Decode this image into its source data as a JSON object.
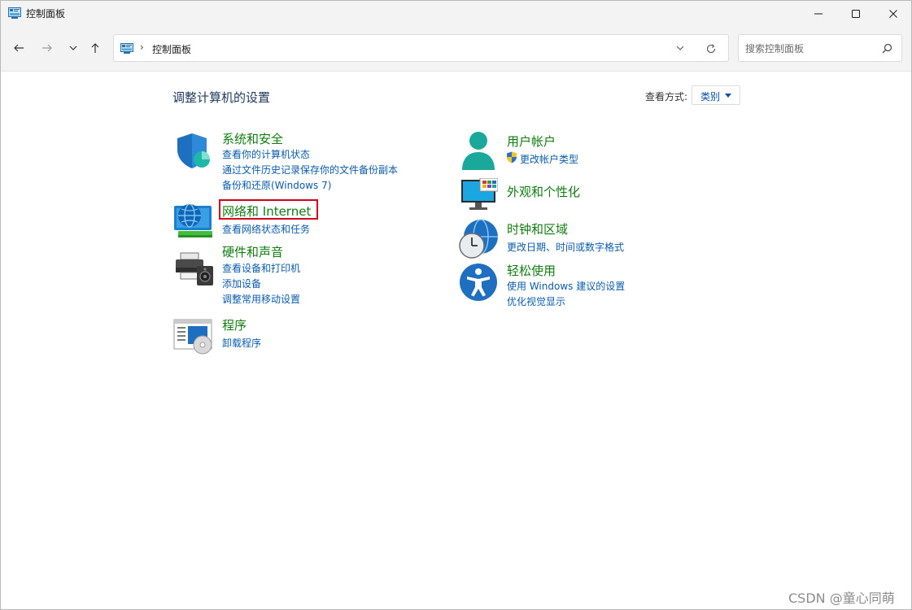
{
  "window": {
    "title": "控制面板",
    "icons": {
      "app": "control-panel-icon",
      "minimize": "minimize-icon",
      "maximize": "maximize-icon",
      "close": "close-icon"
    }
  },
  "navigation": {
    "icons": {
      "back": "arrow-left-icon",
      "forward": "arrow-right-icon",
      "recent": "chevron-down-icon",
      "up": "arrow-up-icon"
    }
  },
  "address_bar": {
    "path": "控制面板",
    "separator": "›",
    "icons": {
      "location": "control-panel-icon",
      "dropdown": "chevron-down-icon",
      "refresh": "refresh-icon"
    }
  },
  "search": {
    "placeholder": "搜索控制面板",
    "icon": "search-icon"
  },
  "main": {
    "heading": "调整计算机的设置",
    "view_by": {
      "label": "查看方式:",
      "selected": "类别"
    },
    "categories_left": [
      {
        "id": "system-security",
        "title": "系统和安全",
        "icon": "shield-icon",
        "links": [
          "查看你的计算机状态",
          "通过文件历史记录保存你的文件备份副本",
          "备份和还原(Windows 7)"
        ]
      },
      {
        "id": "network-internet",
        "title": "网络和 Internet",
        "icon": "globe-network-icon",
        "highlighted": true,
        "links": [
          "查看网络状态和任务"
        ]
      },
      {
        "id": "hardware-sound",
        "title": "硬件和声音",
        "icon": "printer-speaker-icon",
        "links": [
          "查看设备和打印机",
          "添加设备",
          "调整常用移动设置"
        ]
      },
      {
        "id": "programs",
        "title": "程序",
        "icon": "programs-disc-icon",
        "links": [
          "卸载程序"
        ]
      }
    ],
    "categories_right": [
      {
        "id": "user-accounts",
        "title": "用户帐户",
        "icon": "user-icon",
        "links": [
          "更改帐户类型"
        ],
        "link_icon": "uac-shield-icon"
      },
      {
        "id": "appearance",
        "title": "外观和个性化",
        "icon": "monitor-personalize-icon",
        "links": []
      },
      {
        "id": "clock-region",
        "title": "时钟和区域",
        "icon": "clock-globe-icon",
        "links": [
          "更改日期、时间或数字格式"
        ]
      },
      {
        "id": "ease-of-access",
        "title": "轻松使用",
        "icon": "accessibility-icon",
        "links": [
          "使用 Windows 建议的设置",
          "优化视觉显示"
        ]
      }
    ]
  },
  "watermark": "CSDN @童心同萌",
  "colors": {
    "title_green": "#107c10",
    "link_blue": "#0b5cad",
    "heading_blue": "#1e395b",
    "highlight_red": "#d0021b"
  }
}
